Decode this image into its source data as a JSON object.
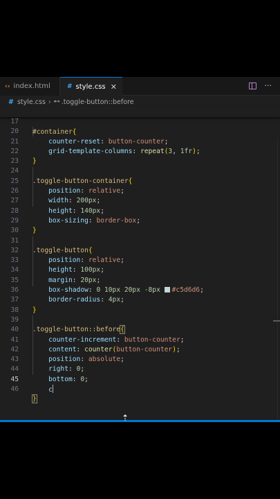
{
  "tabs": [
    {
      "icon": "‹›",
      "label": "index.html",
      "active": false
    },
    {
      "icon": "#",
      "label": "style.css",
      "active": true
    }
  ],
  "close_glyph": "✕",
  "breadcrumb": {
    "file_icon": "#",
    "file": "style.css",
    "symbol_icon": "⊷",
    "symbol": ".toggle-button::before"
  },
  "lines": {
    "n17": "17",
    "n20": "20",
    "n21": "21",
    "n22": "22",
    "n23": "23",
    "n24": "24",
    "n25": "25",
    "n26": "26",
    "n27": "27",
    "n28": "28",
    "n29": "29",
    "n30": "30",
    "n31": "31",
    "n32": "32",
    "n33": "33",
    "n34": "34",
    "n35": "35",
    "n36": "36",
    "n37": "37",
    "n38": "38",
    "n39": "39",
    "n40": "40",
    "n41": "41",
    "n42": "42",
    "n43": "43",
    "n44": "44",
    "n45": "45",
    "n46": "46"
  },
  "code": {
    "l17_sel": "#container",
    "l20_prop": "counter-reset",
    "l20_val": "button-counter",
    "l21_prop": "grid-template-columns",
    "l21_fn": "repeat",
    "l21_a": "3",
    "l21_b": "1fr",
    "l24_sel": ".toggle-button-container",
    "l25_prop": "position",
    "l25_val": "relative",
    "l26_prop": "width",
    "l26_val": "200px",
    "l27_prop": "height",
    "l27_val": "140px",
    "l28_prop": "box-sizing",
    "l28_val": "border-box",
    "l31_sel": ".toggle-button",
    "l32_prop": "position",
    "l32_val": "relative",
    "l33_prop": "height",
    "l33_val": "100px",
    "l34_prop": "margin",
    "l34_val": "20px",
    "l35_prop": "box-shadow",
    "l35_v1": "0 10px 20px -8px",
    "l35_color": "#c5d6d6",
    "l36_prop": "border-radius",
    "l36_val": "4px",
    "l39_sel": ".toggle-button::before",
    "l40_prop": "counter-increment",
    "l40_val": "button-counter",
    "l41_prop": "content",
    "l41_fn": "counter",
    "l41_arg": "button-counter",
    "l42_prop": "position",
    "l42_val": "absolute",
    "l43_prop": "right",
    "l43_val": "0",
    "l44_prop": "bottom",
    "l44_val": "0",
    "l45_typed": "c"
  },
  "colors": {
    "accent": "#0078d4",
    "selector": "#d7ba7d",
    "property": "#9cdcfe",
    "value": "#ce9178",
    "number": "#b5cea8",
    "swatch": "#c5d6d6"
  }
}
